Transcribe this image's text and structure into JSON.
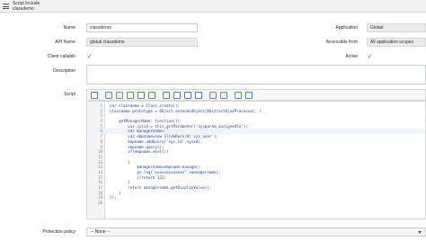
{
  "header": {
    "title": "Script Include",
    "subtitle": "classdemo"
  },
  "form": {
    "name_label": "Name",
    "name_value": "classdemo",
    "application_label": "Application",
    "application_value": "Global",
    "api_name_label": "API Name",
    "api_name_value": "global.classdemo",
    "accessible_from_label": "Accessible from",
    "accessible_from_value": "All application scopes",
    "client_callable_label": "Client callable",
    "client_callable_checked": true,
    "active_label": "Active",
    "active_checked": true,
    "description_label": "Description",
    "description_value": "",
    "script_label": "Script",
    "protection_policy_label": "Protection policy",
    "protection_policy_value": "-- None --"
  },
  "editor": {
    "toolbar_icons": [
      "format-icon",
      "comment-icon",
      "uncomment-icon",
      "toggle-line-numbers-icon",
      "script-tree-icon",
      "debug-icon",
      "search-icon",
      "replace-icon",
      "search-next-icon",
      "search-prev-icon",
      "save-icon",
      "fullscreen-icon",
      "syntax-check-icon",
      "help-icon"
    ],
    "lines": [
      {
        "n": "1",
        "t": "var classdemo = Class.create();"
      },
      {
        "n": "2",
        "t": "classdemo.prototype = Object.extendsObject(AbstractAjaxProcessor, {"
      },
      {
        "n": "3",
        "t": ""
      },
      {
        "n": "4",
        "t": "    getManagerName: function(){"
      },
      {
        "n": "5",
        "t": "        var sysid = this.getParameter('sysparam_assignedTo');"
      },
      {
        "n": "6",
        "t": "        var managername=''"
      },
      {
        "n": "7",
        "t": "        var empname=new GlideRecord('sys_user');"
      },
      {
        "n": "8",
        "t": "        empname.addQuery('sys_id',sysid);"
      },
      {
        "n": "9",
        "t": "        empname.query();"
      },
      {
        "n": "10",
        "t": "        if(empname.next())"
      },
      {
        "n": "11",
        "t": ""
      },
      {
        "n": "12",
        "t": "        {"
      },
      {
        "n": "13",
        "t": "            managername=empname.manager;"
      },
      {
        "n": "14",
        "t": "            gs.log('xxxxxxxxxxxxx' +managername);"
      },
      {
        "n": "15",
        "t": "            //return 123;"
      },
      {
        "n": "16",
        "t": "        }"
      },
      {
        "n": "17",
        "t": "        return managername.getDisplayValue();"
      },
      {
        "n": "18",
        "t": "    }"
      },
      {
        "n": "19",
        "t": "});"
      },
      {
        "n": "20",
        "t": ""
      }
    ]
  }
}
